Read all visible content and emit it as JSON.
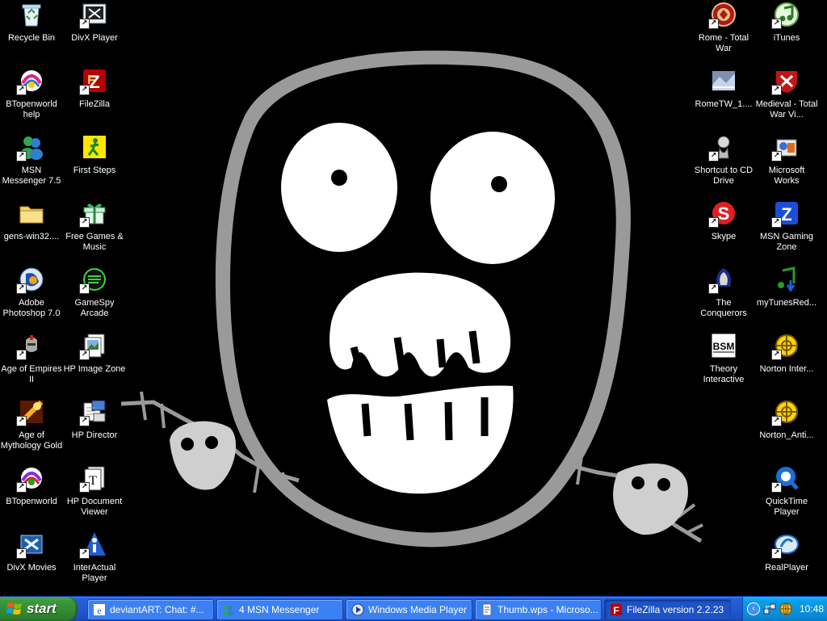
{
  "desktop": {
    "left_col1": [
      {
        "label": "Recycle Bin",
        "icon": "recycle-bin-icon",
        "shortcut": false
      },
      {
        "label": "BTopenworld help",
        "icon": "btopenworld-help-icon",
        "shortcut": true
      },
      {
        "label": "MSN Messenger 7.5",
        "icon": "msn-messenger-icon",
        "shortcut": true
      },
      {
        "label": "gens-win32....",
        "icon": "folder-icon",
        "shortcut": false
      },
      {
        "label": "Adobe Photoshop 7.0",
        "icon": "photoshop-icon",
        "shortcut": true
      },
      {
        "label": "Age of Empires II",
        "icon": "age-of-empires-icon",
        "shortcut": true
      },
      {
        "label": "Age of Mythology Gold",
        "icon": "age-of-mythology-icon",
        "shortcut": true
      },
      {
        "label": "BTopenworld",
        "icon": "btopenworld-icon",
        "shortcut": true
      },
      {
        "label": "DivX Movies",
        "icon": "divx-movies-icon",
        "shortcut": true
      }
    ],
    "left_col2": [
      {
        "label": "DivX Player",
        "icon": "divx-player-icon",
        "shortcut": true
      },
      {
        "label": "FileZilla",
        "icon": "filezilla-icon",
        "shortcut": true
      },
      {
        "label": "First Steps",
        "icon": "first-steps-icon",
        "shortcut": false
      },
      {
        "label": "Free Games & Music",
        "icon": "gift-box-icon",
        "shortcut": true
      },
      {
        "label": "GameSpy Arcade",
        "icon": "gamespy-icon",
        "shortcut": true
      },
      {
        "label": "HP Image Zone",
        "icon": "hp-image-zone-icon",
        "shortcut": true
      },
      {
        "label": "HP Director",
        "icon": "hp-director-icon",
        "shortcut": true
      },
      {
        "label": "HP Document Viewer",
        "icon": "hp-document-viewer-icon",
        "shortcut": true
      },
      {
        "label": "InterActual Player",
        "icon": "interactual-icon",
        "shortcut": true
      }
    ],
    "right_col1": [
      {
        "label": "Rome - Total War",
        "icon": "rome-total-war-icon",
        "shortcut": true
      },
      {
        "label": "RomeTW_1....",
        "icon": "rometw-patch-icon",
        "shortcut": false
      },
      {
        "label": "Shortcut to CD Drive",
        "icon": "cd-drive-icon",
        "shortcut": true
      },
      {
        "label": "Skype",
        "icon": "skype-icon",
        "shortcut": true
      },
      {
        "label": "The Conquerors",
        "icon": "conquerors-icon",
        "shortcut": true
      },
      {
        "label": "Theory Interactive",
        "icon": "bsm-icon",
        "shortcut": false
      }
    ],
    "right_col2": [
      {
        "label": "iTunes",
        "icon": "itunes-icon",
        "shortcut": true
      },
      {
        "label": "Medieval - Total War Vi...",
        "icon": "medieval-total-war-icon",
        "shortcut": true
      },
      {
        "label": "Microsoft Works",
        "icon": "microsoft-works-icon",
        "shortcut": true
      },
      {
        "label": "MSN Gaming Zone",
        "icon": "msn-gaming-zone-icon",
        "shortcut": true
      },
      {
        "label": "myTunesRed...",
        "icon": "mytunesred-icon",
        "shortcut": false
      },
      {
        "label": "Norton Inter...",
        "icon": "norton-icon",
        "shortcut": true
      },
      {
        "label": "Norton_Anti...",
        "icon": "norton-icon",
        "shortcut": true
      },
      {
        "label": "QuickTime Player",
        "icon": "quicktime-icon",
        "shortcut": true
      },
      {
        "label": "RealPlayer",
        "icon": "realplayer-icon",
        "shortcut": true
      }
    ]
  },
  "taskbar": {
    "start_label": "start",
    "tasks": [
      {
        "label": "deviantART: Chat: #...",
        "icon": "ie-icon"
      },
      {
        "label": "4 MSN Messenger",
        "icon": "msn-messenger-icon"
      },
      {
        "label": "Windows Media Player",
        "icon": "media-player-icon"
      },
      {
        "label": "Thumb.wps - Microso...",
        "icon": "works-doc-icon"
      },
      {
        "label": "FileZilla version 2.2.23",
        "icon": "filezilla-icon"
      }
    ],
    "tray": {
      "clock": "10:48",
      "icons": [
        "network-icon",
        "globe-icon"
      ]
    }
  }
}
